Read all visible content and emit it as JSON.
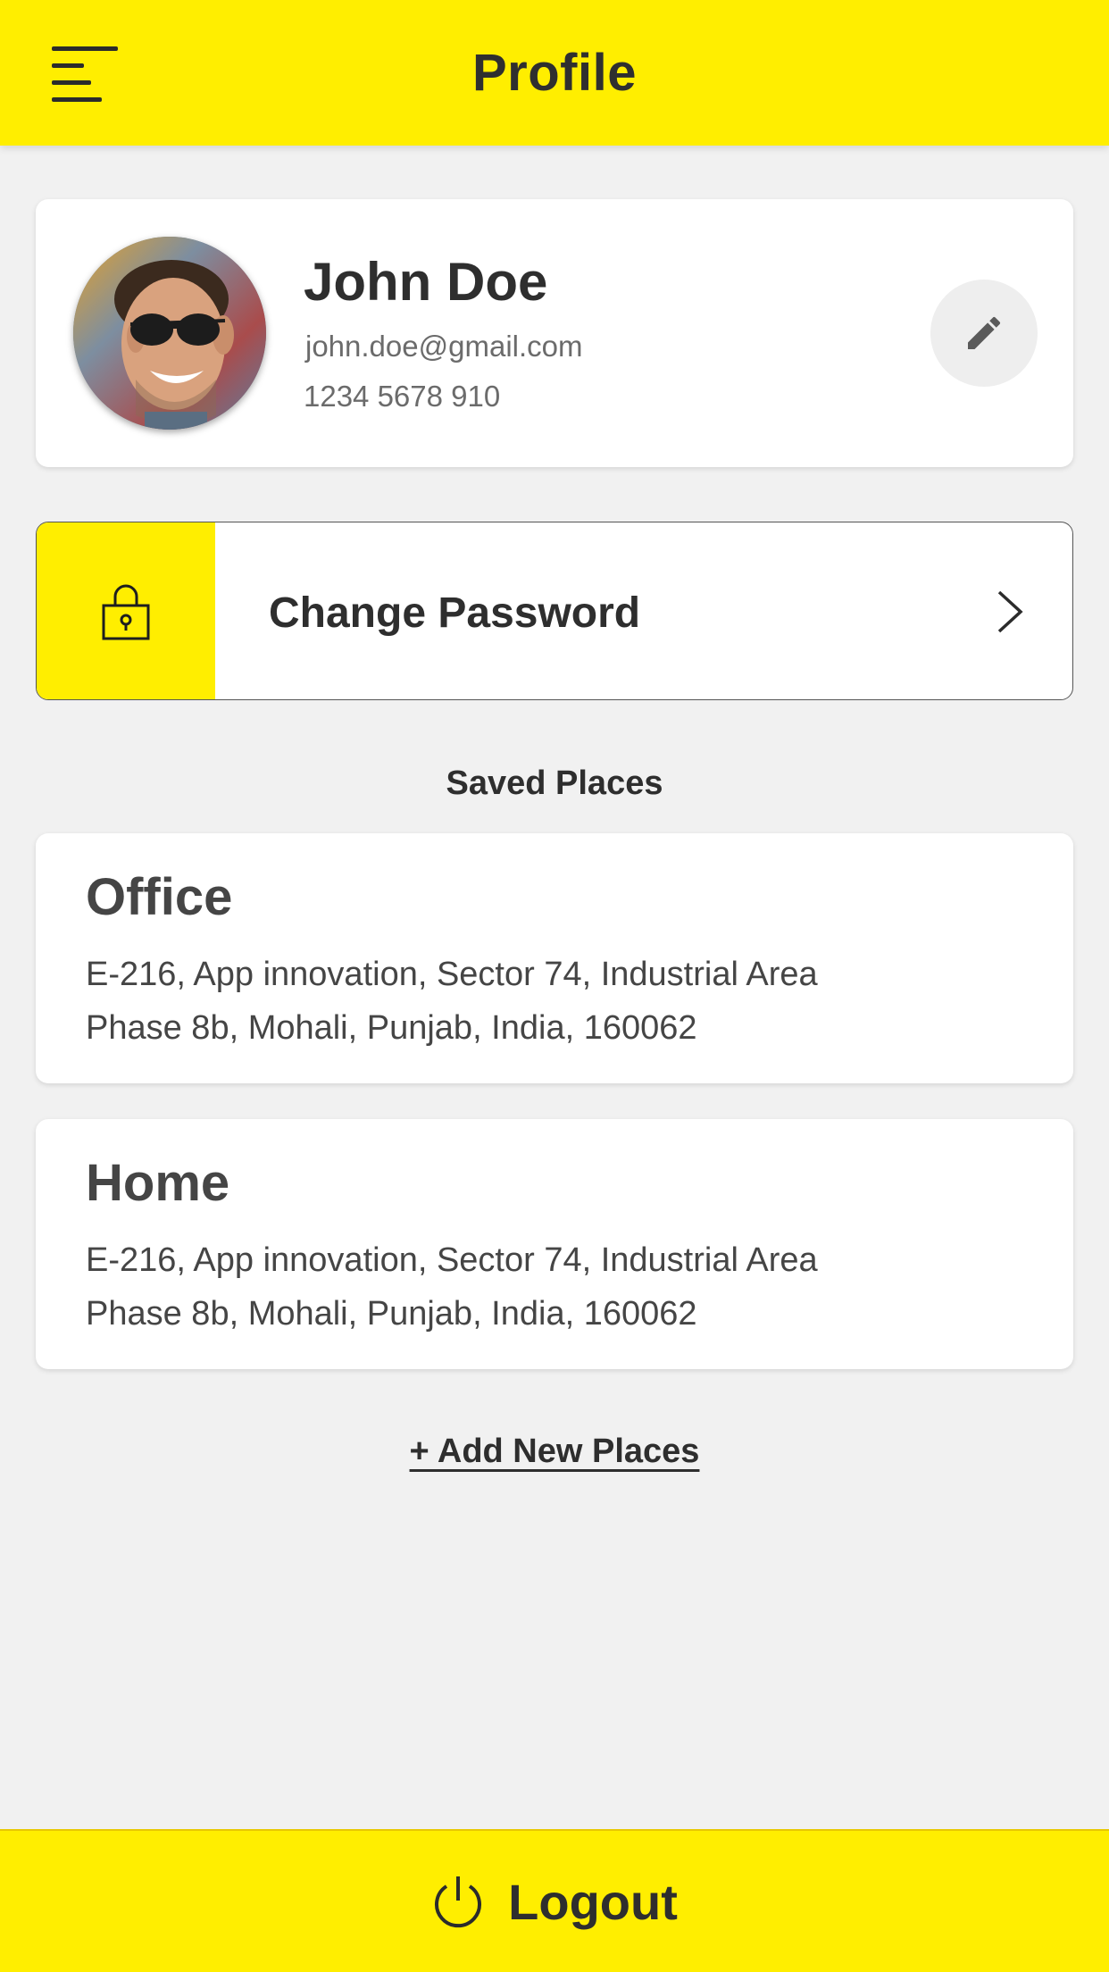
{
  "header": {
    "title": "Profile",
    "menu_icon": "hamburger-menu-icon"
  },
  "profile": {
    "name": "John Doe",
    "email": "john.doe@gmail.com",
    "phone": "1234 5678 910",
    "edit_icon": "pencil-icon"
  },
  "change_password": {
    "label": "Change Password",
    "icon": "lock-icon",
    "chevron_icon": "chevron-right-icon"
  },
  "saved_places": {
    "title": "Saved Places",
    "places": [
      {
        "title": "Office",
        "address_line1": "E-216, App innovation, Sector 74, Industrial Area",
        "address_line2": "Phase 8b, Mohali, Punjab, India, 160062"
      },
      {
        "title": "Home",
        "address_line1": "E-216, App innovation, Sector 74, Industrial Area",
        "address_line2": "Phase 8b, Mohali, Punjab, India, 160062"
      }
    ],
    "add_label": "+ Add New Places"
  },
  "logout": {
    "label": "Logout",
    "icon": "power-icon"
  },
  "colors": {
    "accent": "#ffee00",
    "background": "#f1f1f1",
    "text": "#2e2e2e"
  }
}
